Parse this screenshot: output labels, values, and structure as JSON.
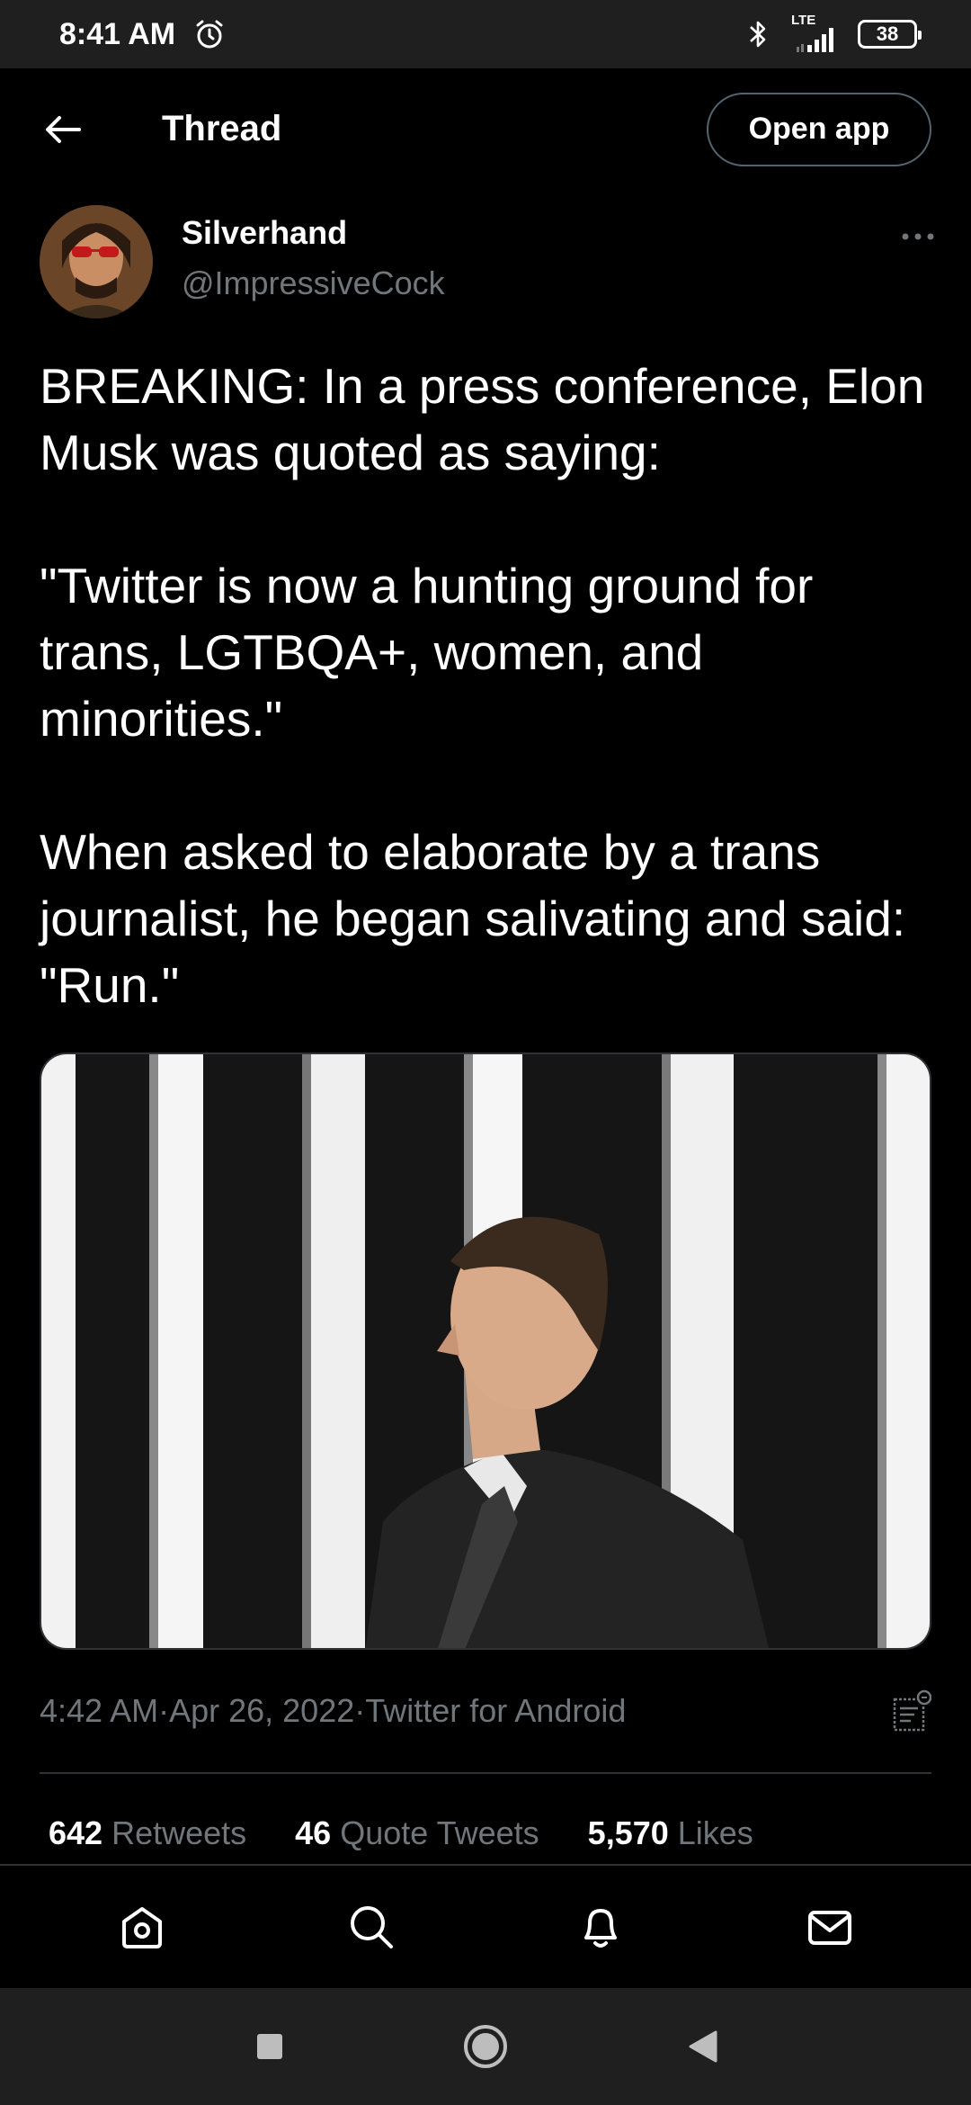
{
  "status_bar": {
    "time": "8:41 AM",
    "network": "LTE",
    "battery": "38",
    "icons": [
      "alarm-icon",
      "bluetooth-icon",
      "signal-icon",
      "battery-icon"
    ]
  },
  "header": {
    "title": "Thread",
    "open_app_label": "Open app",
    "back_icon": "arrow-left-icon"
  },
  "tweet": {
    "author_name": "Silverhand",
    "author_handle": "@ImpressiveCock",
    "text": "BREAKING: In a press conference, Elon Musk was quoted as saying:\n\n\"Twitter is now a hunting ground for trans, LGTBQA+, women, and minorities.\"\n\nWhen asked to elaborate by a trans journalist, he began salivating and said: \"Run.\"",
    "time": "4:42 AM",
    "date": "Apr 26, 2022",
    "source": "Twitter for Android",
    "separator": " · "
  },
  "stats": {
    "retweets_count": "642",
    "retweets_label": "Retweets",
    "quotes_count": "46",
    "quotes_label": "Quote Tweets",
    "likes_count": "5,570",
    "likes_label": "Likes"
  },
  "bottom_nav": {
    "items": [
      "home-icon",
      "search-icon",
      "notifications-icon",
      "messages-icon"
    ]
  },
  "system_nav": {
    "items": [
      "recents-icon",
      "home-circle-icon",
      "back-triangle-icon"
    ]
  },
  "colors": {
    "background": "#000000",
    "text": "#ffffff",
    "secondary_text": "#71767b",
    "border": "#2f3336",
    "system_bar": "#1f1f1f"
  }
}
